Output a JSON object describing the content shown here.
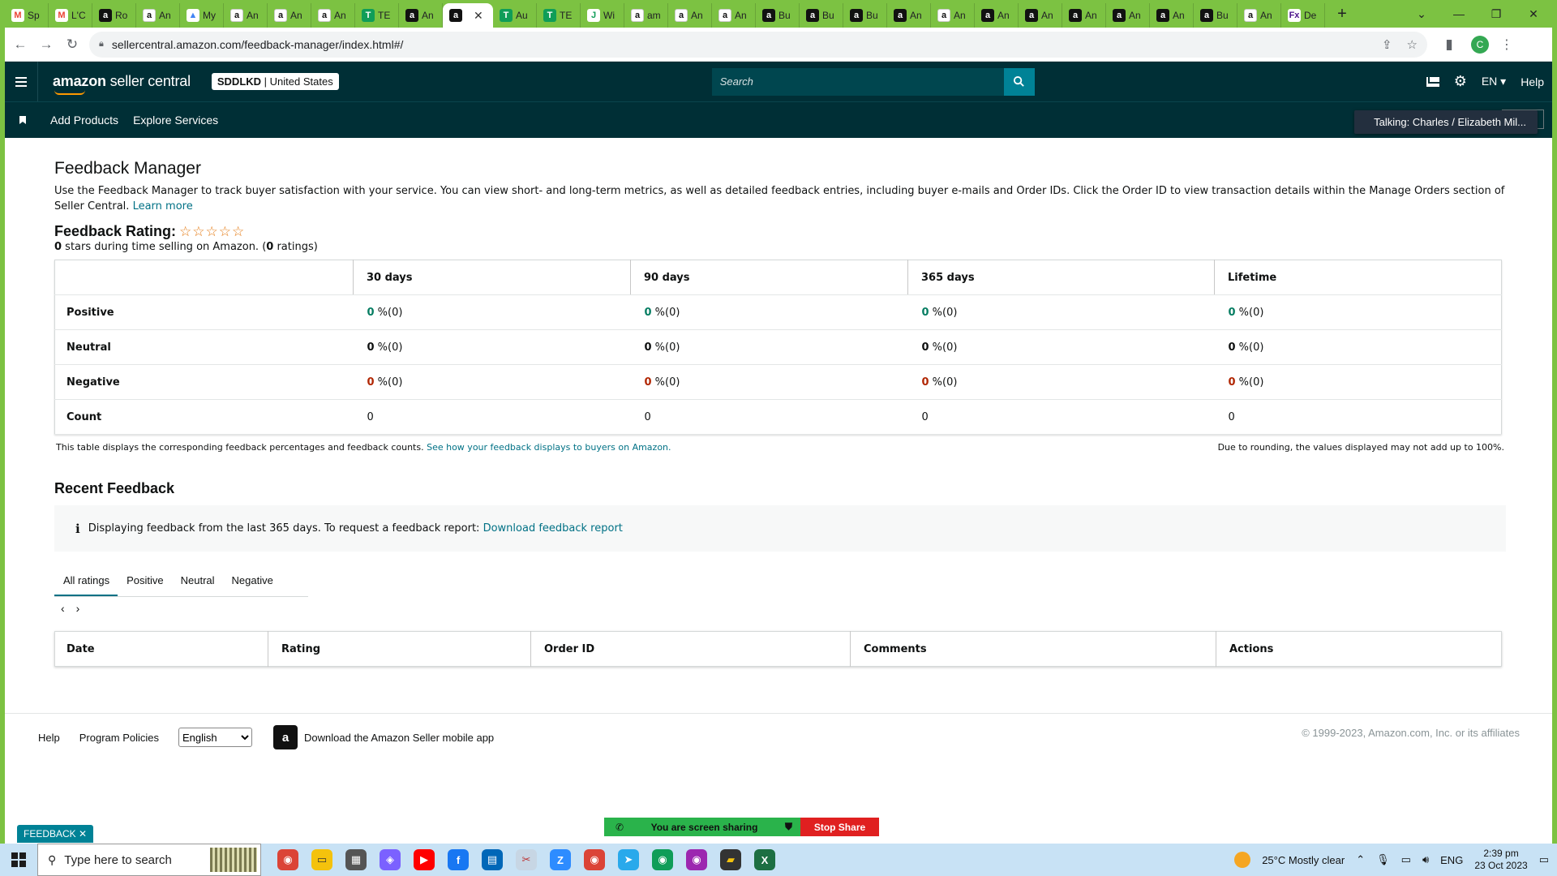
{
  "browser": {
    "tabs": [
      {
        "favicon": "gm",
        "glyph": "M",
        "label": "Sp"
      },
      {
        "favicon": "gm",
        "glyph": "M",
        "label": "L'C"
      },
      {
        "favicon": "amz",
        "glyph": "a",
        "label": "Ro"
      },
      {
        "favicon": "amzw",
        "glyph": "a",
        "label": "An"
      },
      {
        "favicon": "drv",
        "glyph": "▲",
        "label": "My"
      },
      {
        "favicon": "amzw",
        "glyph": "a",
        "label": "An"
      },
      {
        "favicon": "amzw",
        "glyph": "a",
        "label": "An"
      },
      {
        "favicon": "amzw",
        "glyph": "a",
        "label": "An"
      },
      {
        "favicon": "tea",
        "glyph": "T",
        "label": "TE"
      },
      {
        "favicon": "amz",
        "glyph": "a",
        "label": "An"
      },
      {
        "favicon": "amz",
        "glyph": "a",
        "label": "",
        "active": true
      },
      {
        "favicon": "tea",
        "glyph": "T",
        "label": "Au"
      },
      {
        "favicon": "tea",
        "glyph": "T",
        "label": "TE"
      },
      {
        "favicon": "wi",
        "glyph": "J",
        "label": "Wi"
      },
      {
        "favicon": "amzw",
        "glyph": "a",
        "label": "am"
      },
      {
        "favicon": "amzw",
        "glyph": "a",
        "label": "An"
      },
      {
        "favicon": "amzw",
        "glyph": "a",
        "label": "An"
      },
      {
        "favicon": "amz",
        "glyph": "a",
        "label": "Bu"
      },
      {
        "favicon": "amz",
        "glyph": "a",
        "label": "Bu"
      },
      {
        "favicon": "amz",
        "glyph": "a",
        "label": "Bu"
      },
      {
        "favicon": "amz",
        "glyph": "a",
        "label": "An"
      },
      {
        "favicon": "amzw",
        "glyph": "a",
        "label": "An"
      },
      {
        "favicon": "amz",
        "glyph": "a",
        "label": "An"
      },
      {
        "favicon": "amz",
        "glyph": "a",
        "label": "An"
      },
      {
        "favicon": "amz",
        "glyph": "a",
        "label": "An"
      },
      {
        "favicon": "amz",
        "glyph": "a",
        "label": "An"
      },
      {
        "favicon": "amz",
        "glyph": "a",
        "label": "An"
      },
      {
        "favicon": "amz",
        "glyph": "a",
        "label": "Bu"
      },
      {
        "favicon": "amzw",
        "glyph": "a",
        "label": "An"
      },
      {
        "favicon": "fdx",
        "glyph": "Fx",
        "label": "De"
      }
    ],
    "url": "sellercentral.amazon.com/feedback-manager/index.html#/",
    "profile_initial": "C"
  },
  "header": {
    "logo_bold": "amazon",
    "logo_rest": " seller central",
    "store_name": "SDDLKD",
    "store_region": " | United States",
    "search_placeholder": "Search",
    "language": "EN ▾",
    "help": "Help"
  },
  "subnav": {
    "items": [
      "Add Products",
      "Explore Services"
    ],
    "talking": "Talking: Charles / Elizabeth Mil..."
  },
  "main": {
    "title": "Feedback Manager",
    "intro": "Use the Feedback Manager to track buyer satisfaction with your service. You can view short- and long-term metrics, as well as detailed feedback entries, including buyer e-mails and Order IDs. Click the Order ID to view transaction details within the Manage Orders section of Seller Central. ",
    "learn_more": "Learn more",
    "rating_label": "Feedback Rating:",
    "stars": "☆☆☆☆☆",
    "rating_count_stars": "0",
    "rating_sub_a": " stars during time selling on Amazon. (",
    "rating_count_ratings": "0",
    "rating_sub_b": " ratings)",
    "table": {
      "headers": [
        "",
        "30 days",
        "90 days",
        "365 days",
        "Lifetime"
      ],
      "rows": [
        {
          "label": "Positive",
          "kind": "pos",
          "cells": [
            "0",
            "0",
            "0",
            "0"
          ],
          "suffix": " %(0)"
        },
        {
          "label": "Neutral",
          "kind": "zero",
          "cells": [
            "0",
            "0",
            "0",
            "0"
          ],
          "suffix": " %(0)"
        },
        {
          "label": "Negative",
          "kind": "neg",
          "cells": [
            "0",
            "0",
            "0",
            "0"
          ],
          "suffix": " %(0)"
        },
        {
          "label": "Count",
          "kind": "plain",
          "cells": [
            "0",
            "0",
            "0",
            "0"
          ],
          "suffix": ""
        }
      ],
      "note_left": "This table displays the corresponding feedback percentages and feedback counts. ",
      "note_link": "See how your feedback displays to buyers on Amazon.",
      "note_right": "Due to rounding, the values displayed may not add up to 100%."
    },
    "recent": {
      "title": "Recent Feedback",
      "info_icon": "i",
      "info_text": "Displaying feedback from the last 365 days. To request a feedback report: ",
      "info_link": "Download feedback report",
      "tabs": [
        "All ratings",
        "Positive",
        "Neutral",
        "Negative"
      ],
      "prev": "‹",
      "next": "›",
      "columns": [
        "Date",
        "Rating",
        "Order ID",
        "Comments",
        "Actions"
      ]
    }
  },
  "footer": {
    "help": "Help",
    "policies": "Program Policies",
    "language": "English",
    "app_text": "Download the Amazon Seller mobile app",
    "copyright": "© 1999-2023, Amazon.com, Inc. or its affiliates"
  },
  "overlay": {
    "feedback_tab": "FEEDBACK ✕",
    "sharing": "You are screen sharing",
    "stop": "Stop Share"
  },
  "taskbar": {
    "search_placeholder": "Type here to search",
    "weather": "25°C  Mostly clear",
    "lang": "ENG",
    "time": "2:39 pm",
    "date": "23 Oct 2023"
  }
}
